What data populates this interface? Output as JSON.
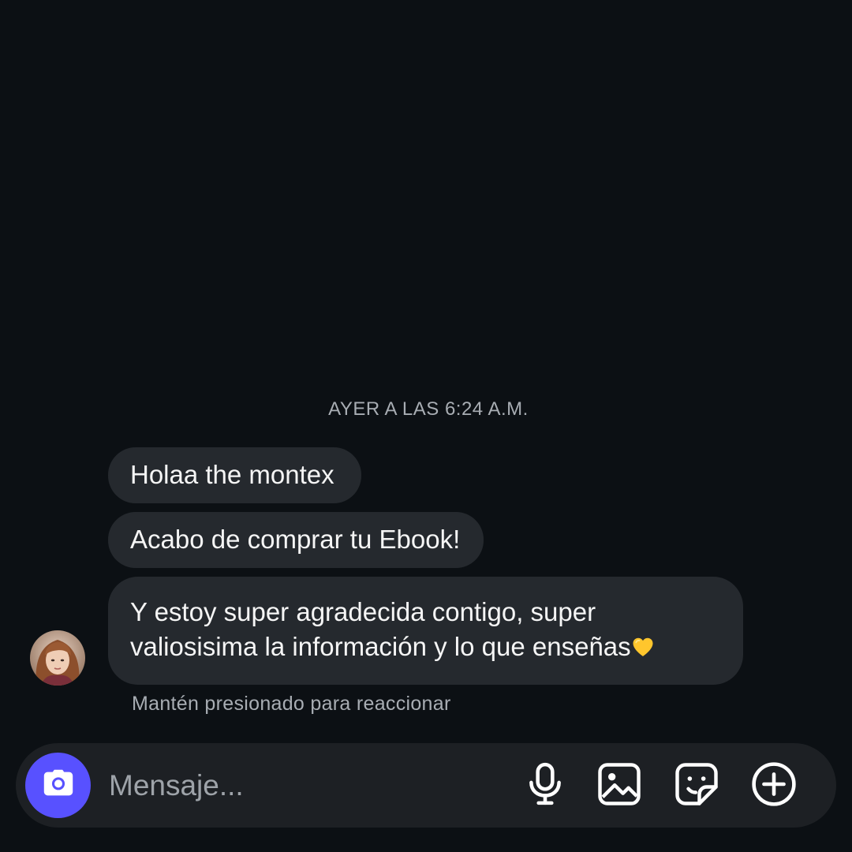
{
  "chat": {
    "timestamp": "AYER A LAS 6:24 A.M.",
    "messages": [
      {
        "text": "Holaa the montex"
      },
      {
        "text": "Acabo de comprar tu Ebook!"
      },
      {
        "line1": "Y estoy super agradecida contigo, super",
        "line2": "valiosisima la información y lo que enseñas",
        "emoji": "yellow-heart"
      }
    ],
    "react_hint": "Mantén presionado para reaccionar"
  },
  "composer": {
    "placeholder": "Mensaje...",
    "icons": [
      "camera-icon",
      "microphone-icon",
      "gallery-icon",
      "sticker-icon",
      "plus-icon"
    ],
    "camera_color": "#5851ff"
  },
  "theme": {
    "background": "#0c1014",
    "bubble": "#25292e",
    "composer": "#1d2024"
  }
}
